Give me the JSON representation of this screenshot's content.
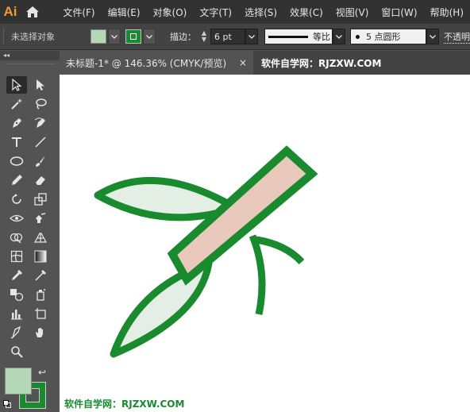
{
  "app": {
    "logo": "Ai"
  },
  "menu": [
    "文件(F)",
    "编辑(E)",
    "对象(O)",
    "文字(T)",
    "选择(S)",
    "效果(C)",
    "视图(V)",
    "窗口(W)",
    "帮助(H)"
  ],
  "control": {
    "selection_status": "未选择对象",
    "stroke_label": "描边：",
    "stroke_weight": "6 pt",
    "profile_label": "等比",
    "brush_label": "5 点圆形",
    "opacity_label": "不透明"
  },
  "document": {
    "tab_title": "未标题-1* @ 146.36% (CMYK/预览)",
    "close_glyph": "×"
  },
  "watermark": "软件自学网：RJZXW.COM",
  "colors": {
    "fill": "#b5d9b6",
    "stroke": "#1a8a2f",
    "leaf_fill": "#e3efe4",
    "stem_fill": "#e9c9bb"
  },
  "tools": [
    [
      "selection-tool",
      "direct-selection-tool"
    ],
    [
      "magic-wand-tool",
      "lasso-tool"
    ],
    [
      "pen-tool",
      "curvature-tool"
    ],
    [
      "type-tool",
      "line-segment-tool"
    ],
    [
      "ellipse-tool",
      "paintbrush-tool"
    ],
    [
      "pencil-tool",
      "eraser-tool"
    ],
    [
      "rotate-tool",
      "scale-tool"
    ],
    [
      "width-tool",
      "puppet-warp-tool"
    ],
    [
      "shape-builder-tool",
      "perspective-grid-tool"
    ],
    [
      "mesh-tool",
      "gradient-tool"
    ],
    [
      "eyedropper-tool",
      "measure-tool"
    ],
    [
      "blend-tool",
      "symbol-sprayer-tool"
    ],
    [
      "column-graph-tool",
      "artboard-tool"
    ],
    [
      "slice-tool",
      "hand-tool"
    ],
    [
      "zoom-tool"
    ]
  ],
  "toolbar_collapse": "◂◂"
}
